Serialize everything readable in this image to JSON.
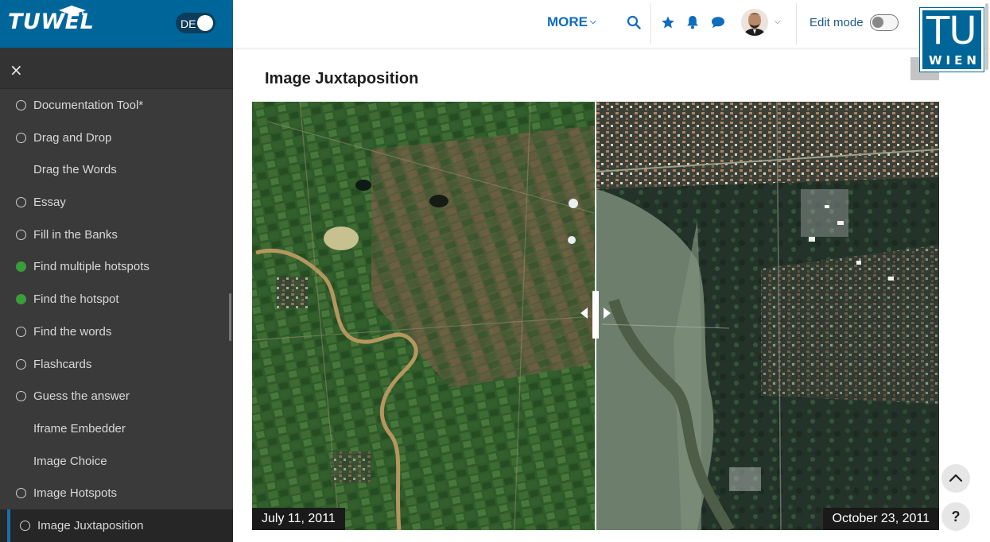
{
  "brand": {
    "name": "TUWEL",
    "lang_label": "DE"
  },
  "sidebar": {
    "close_icon": "×",
    "items": [
      {
        "label": "Documentation Tool*",
        "status": "incomplete"
      },
      {
        "label": "Drag and Drop",
        "status": "incomplete"
      },
      {
        "label": "Drag the Words",
        "status": "none"
      },
      {
        "label": "Essay",
        "status": "incomplete"
      },
      {
        "label": "Fill in the Banks",
        "status": "incomplete"
      },
      {
        "label": "Find multiple hotspots",
        "status": "complete"
      },
      {
        "label": "Find the hotspot",
        "status": "complete"
      },
      {
        "label": "Find the words",
        "status": "incomplete"
      },
      {
        "label": "Flashcards",
        "status": "incomplete"
      },
      {
        "label": "Guess the answer",
        "status": "incomplete"
      },
      {
        "label": "Iframe Embedder",
        "status": "none"
      },
      {
        "label": "Image Choice",
        "status": "none"
      },
      {
        "label": "Image Hotspots",
        "status": "incomplete"
      },
      {
        "label": "Image Juxtaposition",
        "status": "incomplete",
        "active": true
      }
    ]
  },
  "topbar": {
    "more_label": "MORE",
    "edit_mode_label": "Edit mode",
    "edit_mode_on": false,
    "icons": [
      "search-icon",
      "star-icon",
      "bell-icon",
      "chat-icon"
    ]
  },
  "tu_logo": {
    "top": "TU",
    "bottom": "WIEN"
  },
  "main": {
    "title": "Image Juxtaposition",
    "before_label": "July 11, 2011",
    "after_label": "October 23, 2011",
    "slider_position": 0.5
  },
  "colors": {
    "brand": "#006699",
    "accent": "#0f6cbf",
    "complete": "#3a9c3a"
  }
}
